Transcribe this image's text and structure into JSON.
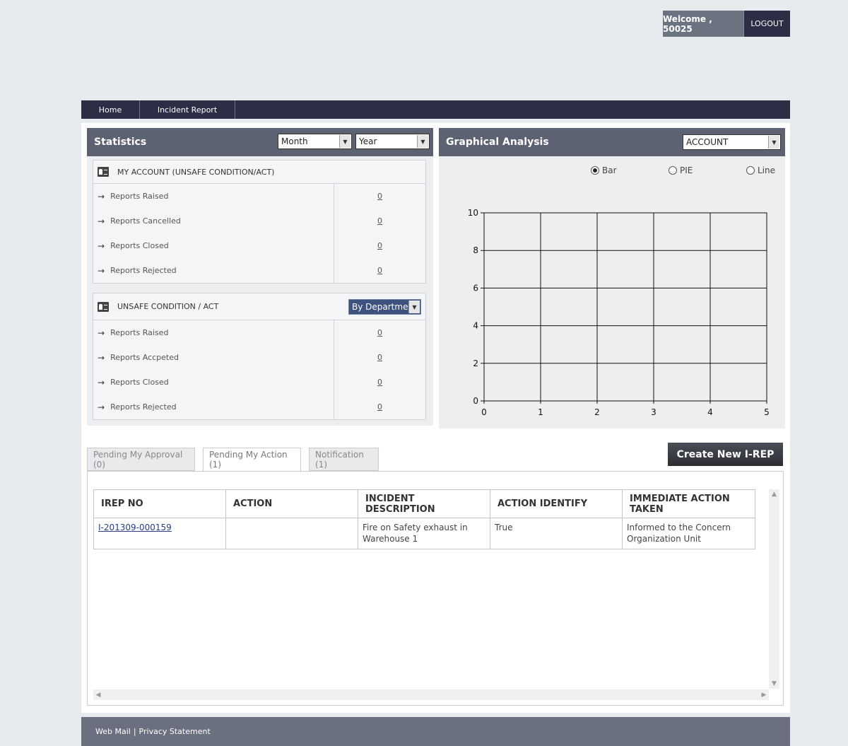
{
  "header": {
    "welcome": "Welcome , 50025",
    "logout": "LOGOUT"
  },
  "nav": {
    "home": "Home",
    "incident_report": "Incident Report"
  },
  "statistics": {
    "title": "Statistics",
    "month_select": "Month",
    "year_select": "Year",
    "my_account": {
      "title": "MY ACCOUNT (UNSAFE CONDITION/ACT)",
      "rows": [
        {
          "label": "Reports Raised",
          "value": "0"
        },
        {
          "label": "Reports Cancelled",
          "value": "0"
        },
        {
          "label": "Reports Closed",
          "value": "0"
        },
        {
          "label": "Reports Rejected",
          "value": "0"
        }
      ]
    },
    "unsafe": {
      "title": "UNSAFE CONDITION / ACT",
      "filter": "By Department",
      "rows": [
        {
          "label": "Reports Raised",
          "value": "0"
        },
        {
          "label": "Reports Accpeted",
          "value": "0"
        },
        {
          "label": "Reports Closed",
          "value": "0"
        },
        {
          "label": "Reports Rejected",
          "value": "0"
        }
      ]
    }
  },
  "graph": {
    "title": "Graphical Analysis",
    "select": "ACCOUNT",
    "radio_bar": "Bar",
    "radio_pie": "PIE",
    "radio_line": "Line",
    "selected": "Bar"
  },
  "chart_data": {
    "type": "bar",
    "x_ticks": [
      "0",
      "1",
      "2",
      "3",
      "4",
      "5"
    ],
    "y_ticks": [
      "0",
      "2",
      "4",
      "6",
      "8",
      "10"
    ],
    "xlim": [
      0,
      5
    ],
    "ylim": [
      0,
      10
    ],
    "grid": true,
    "values": []
  },
  "tabs": {
    "pending_approval": "Pending My Approval (0)",
    "pending_action": "Pending My Action (1)",
    "notification": "Notification (1)"
  },
  "create_button": "Create New I-REP",
  "table": {
    "headers": [
      "IREP NO",
      "ACTION",
      "INCIDENT DESCRIPTION",
      "ACTION IDENTIFY",
      "IMMEDIATE ACTION TAKEN"
    ],
    "rows": [
      {
        "irep_no": "I-201309-000159",
        "action": "",
        "description": "Fire on Safety exhaust in Warehouse 1",
        "identify": "True",
        "immediate": "Informed to the Concern Organization Unit"
      }
    ]
  },
  "footer": {
    "webmail": "Web Mail",
    "separator": "|",
    "privacy": "Privacy Statement"
  },
  "icons": {
    "arrow": "→",
    "dropdown": "▼",
    "scroll_up": "▲",
    "scroll_down": "▼",
    "scroll_left": "◀",
    "scroll_right": "▶"
  }
}
